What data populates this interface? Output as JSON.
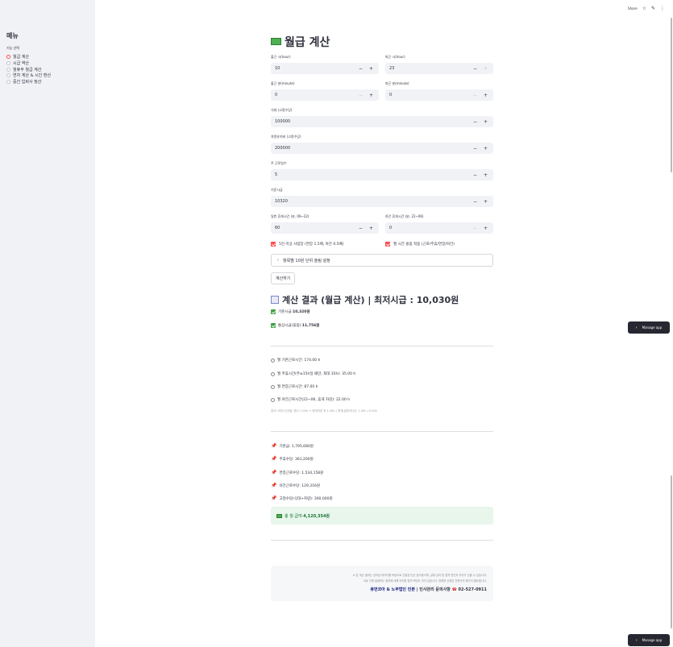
{
  "sidebar": {
    "title": "메뉴",
    "radio_label": "기능 선택",
    "options": [
      "월급 계산",
      "시급 역산",
      "월휴무 월급 계산",
      "연차 계산 & 시간 환산",
      "중간 입퇴사 정산"
    ],
    "selected_index": 0
  },
  "topbar": {
    "share": "Share",
    "star_icon": "☆",
    "edit_icon": "✎",
    "more_icon": "⋮"
  },
  "main": {
    "title": "월급 계산",
    "fields": {
      "start_hour": {
        "label": "출근 시(hour)",
        "value": "10"
      },
      "end_hour": {
        "label": "퇴근 시(hour)",
        "value": "23"
      },
      "start_minute": {
        "label": "출근 분(minute)",
        "value": "0"
      },
      "end_minute": {
        "label": "퇴근 분(minute)",
        "value": "0"
      },
      "meal": {
        "label": "식대 (고정수당)",
        "value": "100000"
      },
      "car": {
        "label": "차량유지비 (고정수당)",
        "value": "200000"
      },
      "work_days": {
        "label": "주 근로일수",
        "value": "5"
      },
      "base_wage": {
        "label": "기준시급",
        "value": "10320"
      },
      "break_day": {
        "label": "일반 휴게시간 (분, 06~22)",
        "value": "60"
      },
      "break_night": {
        "label": "야간 휴게시간 (분, 22~06)",
        "value": "0"
      }
    },
    "minus": "−",
    "plus": "+",
    "check_under5": "5인 미상 사업장 (연장 1.5배, 야간 0.5배)",
    "check_round": "월 시간 올림 적용 (근로/주휴/연장/야간)",
    "expander_label": "항목별 10원 단위 올림 설정",
    "calc_button": "계산하기"
  },
  "result": {
    "title": "계산 결과 (월급 계산) | 최저시급 : 10,030원",
    "base_wage_label": "기준시급: ",
    "base_wage_value": "10,320원",
    "ordinary_wage_label": "통상시급(올림): ",
    "ordinary_wage_value": "11,756원",
    "hours": [
      "월 기본근로시간: 174.00 h",
      "월 주휴시간(주≥15h일 때만, 최대 35h): 35.00 h",
      "월 연장근로시간: 87.00 h",
      "월 야간근로시간(22~06, 휴게 차감): 22.00 h"
    ],
    "note": "참고) 야간시간/일: 원시 1.00h → 휴게차감 후 1.00h | 휴게(일반/야간): 1.00h / 0.00h",
    "pays": [
      "기본급: 1,795,680원",
      "주휴수당: 361,200원",
      "연장근로수당: 1,534,158원",
      "야간근로수당: 129,316원",
      "고정수당(식대+차량): 300,000원"
    ],
    "total_label": "총 월 급여: ",
    "total_value": "4,120,354원"
  },
  "footer": {
    "line1": "※ 본 계산 결과는 입력된 데이터를 바탕으로 산출된 단순 참고용이며, 실제 급여 및 법적 판단과 차이가 있을 수 있습니다.",
    "line2": "이로 인해 발생하는 결과에 대해 어떠한 법적 책임도 지지 않습니다. 정확한 산정은 전문가의 확인이 필요합니다.",
    "brand": "휴먼코아 & 노무법인 인본",
    "contact": " | 인사관리 문의사항 ",
    "phone": "02-527-0911"
  },
  "manage_app": "Manage app"
}
